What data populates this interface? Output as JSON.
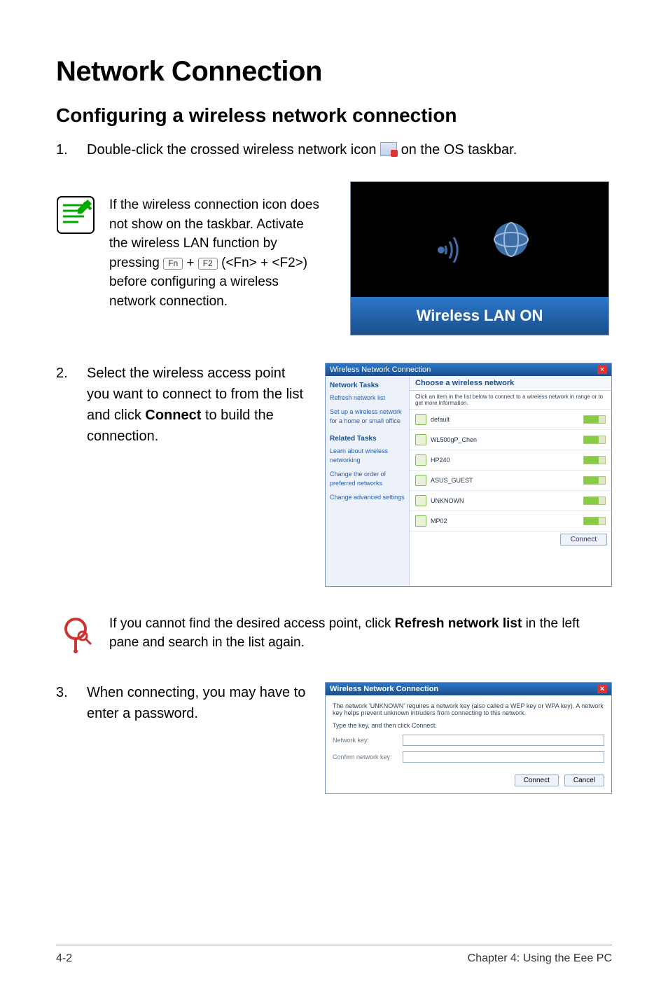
{
  "heading1": "Network Connection",
  "heading2": "Configuring a wireless network connection",
  "step1": {
    "num": "1.",
    "text_before": "Double-click the crossed wireless network icon ",
    "text_after": " on the OS taskbar."
  },
  "note": {
    "line1": "If the wireless connection icon does not show on the taskbar. Activate the wireless LAN function by pressing ",
    "key1": "Fn",
    "plus": " + ",
    "key2_top": "F2",
    "key2_sub": "",
    "paren": " (<Fn> + <F2>) before configuring a wireless network connection."
  },
  "wlan_shot": {
    "bar": "Wireless LAN ON"
  },
  "step2": {
    "num": "2.",
    "text_a": "Select the wireless access point you want to connect to from the list and click ",
    "text_bold": "Connect",
    "text_b": " to build the connection."
  },
  "list_shot": {
    "title": "Wireless Network Connection",
    "header": "Choose a wireless network",
    "desc": "Click an item in the list below to connect to a wireless network in range or to get more information.",
    "side_head1": "Network Tasks",
    "side_items1": [
      "Refresh network list",
      "Set up a wireless network for a home or small office"
    ],
    "side_head2": "Related Tasks",
    "side_items2": [
      "Learn about wireless networking",
      "Change the order of preferred networks",
      "Change advanced settings"
    ],
    "aps": [
      {
        "ssid": "default"
      },
      {
        "ssid": "WL500gP_Chen"
      },
      {
        "ssid": "HP240"
      },
      {
        "ssid": "ASUS_GUEST"
      },
      {
        "ssid": "UNKNOWN"
      },
      {
        "ssid": "MP02"
      }
    ],
    "connect_btn": "Connect"
  },
  "tip": {
    "text_a": "If you cannot find the desired access point, click ",
    "text_bold": "Refresh network list",
    "text_b": " in the left pane and search in the list again."
  },
  "step3": {
    "num": "3.",
    "text": "When connecting, you may have to enter a password."
  },
  "pass_shot": {
    "title": "Wireless Network Connection",
    "desc": "The network 'UNKNOWN' requires a network key (also called a WEP key or WPA key). A network key helps prevent unknown intruders from connecting to this network.",
    "hint": "Type the key, and then click Connect.",
    "lbl1": "Network key:",
    "lbl2": "Confirm network key:",
    "btn_connect": "Connect",
    "btn_cancel": "Cancel"
  },
  "footer": {
    "left": "4-2",
    "right": "Chapter 4: Using the Eee PC"
  }
}
